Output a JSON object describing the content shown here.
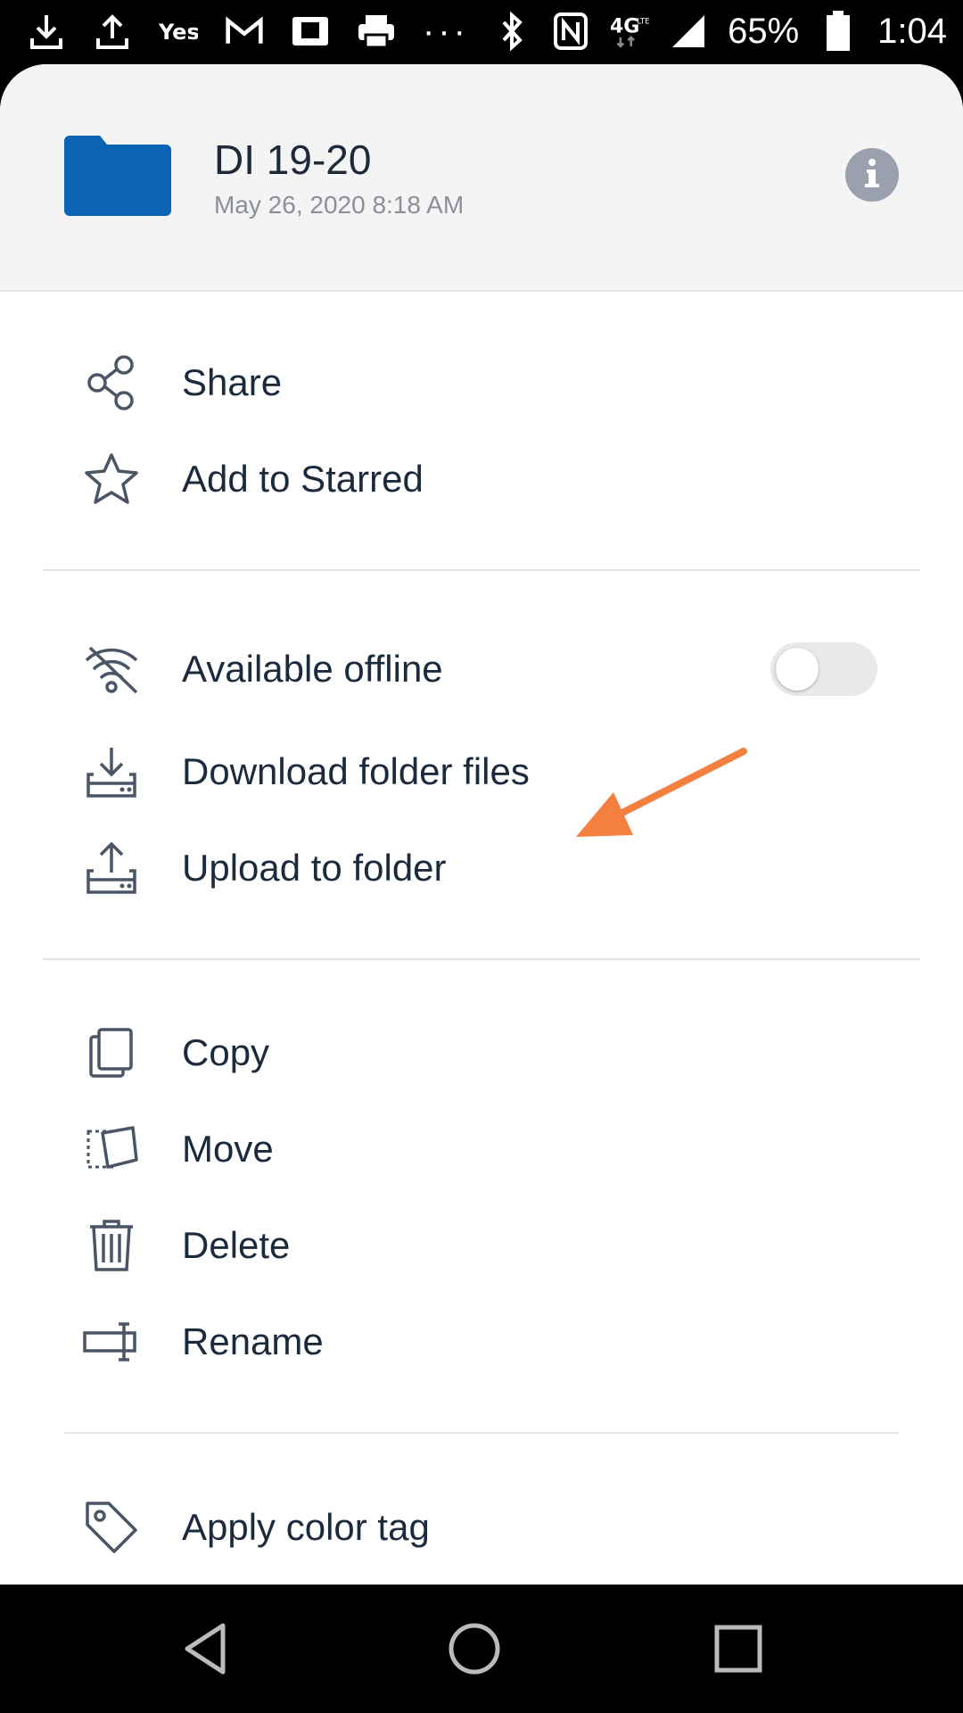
{
  "status_bar": {
    "left_icons": [
      "download-icon",
      "upload-icon",
      "yes-icon",
      "gmail-icon",
      "kindle-icon",
      "printer-icon"
    ],
    "more": "···",
    "right_icons": [
      "bluetooth-icon",
      "nfc-icon",
      "4g-lte-icon",
      "signal-icon"
    ],
    "battery": "65%",
    "time": "1:04"
  },
  "header": {
    "title": "DI 19-20",
    "subtitle": "May 26, 2020 8:18 AM",
    "folder_color": "#0b63b4"
  },
  "menu": {
    "share": "Share",
    "star": "Add to Starred",
    "offline": "Available offline",
    "download": "Download folder files",
    "upload": "Upload to folder",
    "copy": "Copy",
    "move": "Move",
    "delete": "Delete",
    "rename": "Rename",
    "color_tag": "Apply color tag"
  },
  "offline_toggle": {
    "on": false
  },
  "colors": {
    "annotation_arrow": "#f47f3e",
    "text": "#1c2a3d",
    "icon": "#4a5566"
  }
}
